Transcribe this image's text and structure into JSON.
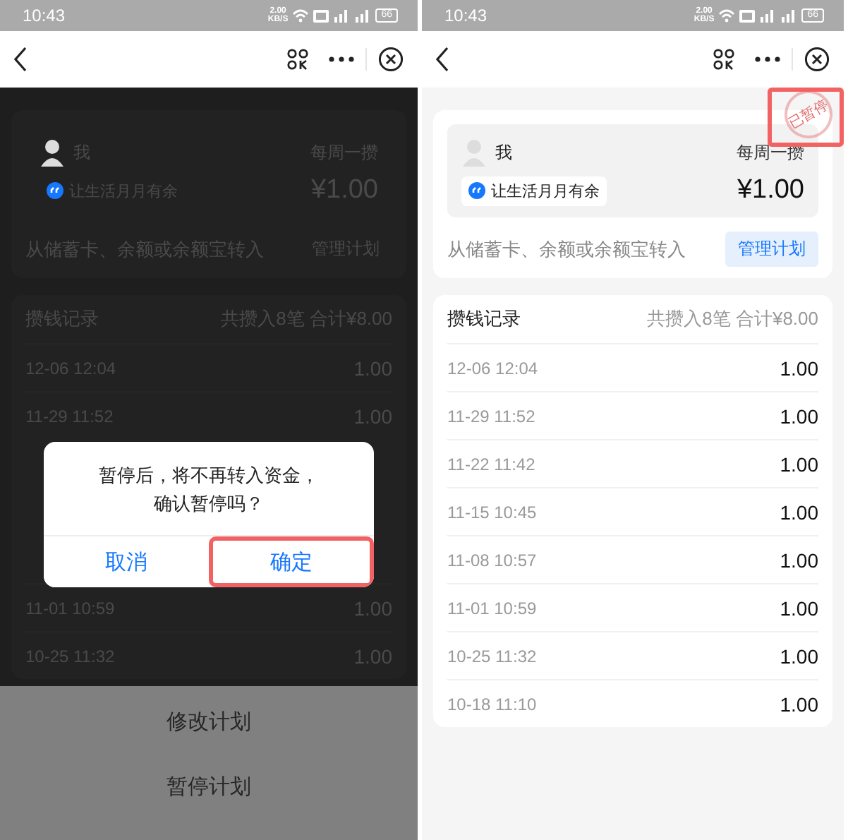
{
  "screens": [
    {
      "dimmed": true,
      "status_bar": {
        "time": "10:43",
        "speed": "2.00",
        "speed_unit": "KB/S",
        "battery": "66"
      },
      "plan": {
        "owner": "我",
        "frequency": "每周一攒",
        "tag": "让生活月月有余",
        "amount": "¥1.00",
        "source": "从储蓄卡、余额或余额宝转入",
        "manage_button": "管理计划"
      },
      "records": {
        "title": "攒钱记录",
        "summary": "共攒入8笔 合计¥8.00",
        "rows": [
          {
            "kind": "entry",
            "date": "12-06 12:04",
            "amount": "1.00"
          },
          {
            "kind": "entry",
            "date": "11-29 11:52",
            "amount": "1.00"
          },
          {
            "kind": "dialog",
            "message": "暂停后，将不再转入资金，确认暂停吗？",
            "buttons": [
              {
                "label": "取消",
                "highlighted": false
              },
              {
                "label": "确定",
                "highlighted": true
              }
            ]
          },
          {
            "kind": "entry",
            "date": "11-01 10:59",
            "amount": "1.00"
          },
          {
            "kind": "entry",
            "date": "10-25 11:32",
            "amount": "1.00"
          }
        ]
      },
      "sheet": {
        "items": [
          "修改计划",
          "暂停计划"
        ]
      }
    },
    {
      "dimmed": false,
      "status_bar": {
        "time": "10:43",
        "speed": "2.00",
        "speed_unit": "KB/S",
        "battery": "66"
      },
      "plan": {
        "owner": "我",
        "frequency": "每周一攒",
        "tag": "让生活月月有余",
        "amount": "¥1.00",
        "source": "从储蓄卡、余额或余额宝转入",
        "manage_button": "管理计划"
      },
      "stamp": {
        "label": "已暂停",
        "highlighted": true
      },
      "records": {
        "title": "攒钱记录",
        "summary": "共攒入8笔 合计¥8.00",
        "rows": [
          {
            "kind": "entry",
            "date": "12-06 12:04",
            "amount": "1.00"
          },
          {
            "kind": "entry",
            "date": "11-29 11:52",
            "amount": "1.00"
          },
          {
            "kind": "entry",
            "date": "11-22 11:42",
            "amount": "1.00"
          },
          {
            "kind": "entry",
            "date": "11-15 10:45",
            "amount": "1.00"
          },
          {
            "kind": "entry",
            "date": "11-08 10:57",
            "amount": "1.00"
          },
          {
            "kind": "entry",
            "date": "11-01 10:59",
            "amount": "1.00"
          },
          {
            "kind": "entry",
            "date": "10-25 11:32",
            "amount": "1.00"
          },
          {
            "kind": "entry",
            "date": "10-18 11:10",
            "amount": "1.00"
          }
        ]
      }
    }
  ]
}
